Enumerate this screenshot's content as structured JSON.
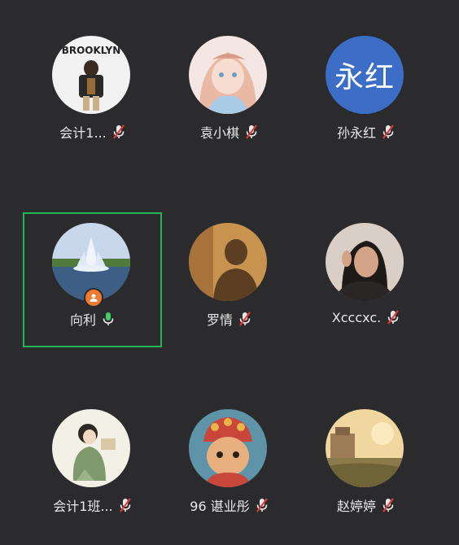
{
  "participants": [
    {
      "name": "会计1...",
      "mic": "muted",
      "avatar": "photo-brooklyn-figure"
    },
    {
      "name": "袁小棋",
      "mic": "muted",
      "avatar": "anime-girl"
    },
    {
      "name": "孙永红",
      "mic": "muted",
      "avatar_text": "永红",
      "avatar_color": "#3c6ec7"
    },
    {
      "name": "向利",
      "mic": "active",
      "avatar": "fountain-lake",
      "host": true
    },
    {
      "name": "罗情",
      "mic": "muted",
      "avatar": "shadow-on-wall"
    },
    {
      "name": "Xcccxc.",
      "mic": "muted",
      "avatar": "woman-portrait"
    },
    {
      "name": "会计1班...",
      "mic": "muted",
      "avatar": "painted-girl"
    },
    {
      "name": "96 谌业彤",
      "mic": "muted",
      "avatar": "cat-with-headdress"
    },
    {
      "name": "赵婷婷",
      "mic": "muted",
      "avatar": "sunset-landscape"
    }
  ],
  "colors": {
    "background": "#2b2b2e",
    "active_border": "#22b55a",
    "muted_red": "#e53935",
    "mic_active": "#3ecf6c",
    "host_badge": "#f07a2e"
  },
  "icons": {
    "muted": "mic-off-icon",
    "active": "mic-icon",
    "host": "host-person-icon"
  }
}
